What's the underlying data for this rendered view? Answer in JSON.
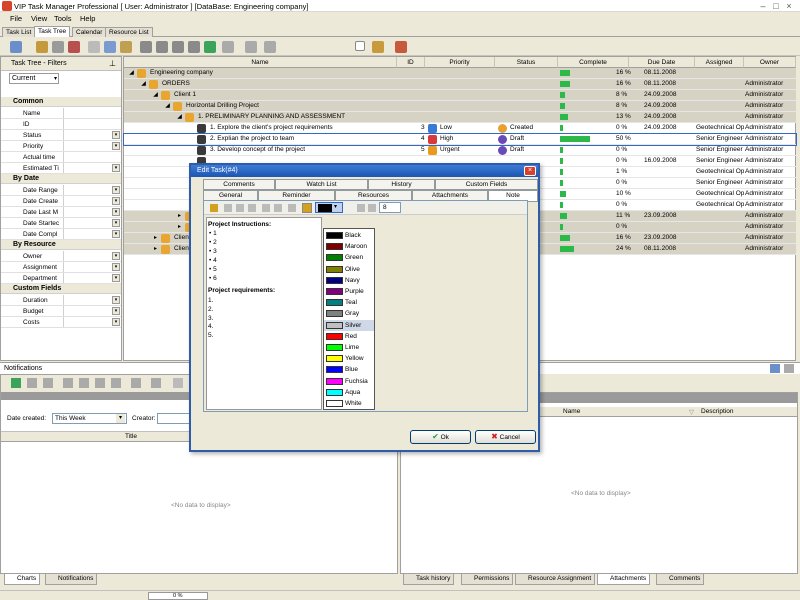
{
  "window": {
    "title": "VIP Task Manager Professional [ User: Administrator ] [DataBase: Engineering company]"
  },
  "menu": [
    "File",
    "View",
    "Tools",
    "Help"
  ],
  "main_tabs": [
    "Task List",
    "Task Tree",
    "Calendar",
    "Resource List"
  ],
  "left_panel": {
    "title": "Task Tree - Filters",
    "filter_value": "Current",
    "sections": [
      {
        "name": "Common",
        "props": [
          "Name",
          "ID",
          "Status",
          "Priority",
          "Actual time",
          "Estimated Ti"
        ]
      },
      {
        "name": "By Date",
        "props": [
          "Date Range",
          "Date Create",
          "Date Last M",
          "Date Startec",
          "Date Compl"
        ]
      },
      {
        "name": "By Resource",
        "props": [
          "Owner",
          "Assignment",
          "Department"
        ]
      },
      {
        "name": "Custom Fields",
        "props": [
          "Duration",
          "Budget",
          "Costs"
        ]
      }
    ]
  },
  "grid": {
    "headers": [
      "Name",
      "ID",
      "Priority",
      "Status",
      "Complete",
      "Due Date",
      "Assigned",
      "Owner"
    ],
    "rows": [
      {
        "name": "Engineering company",
        "level": 0,
        "grey": true,
        "id": "",
        "priority": "",
        "status": "",
        "complete": "16 %",
        "pct": 16,
        "due": "08.11.2008",
        "assigned": "",
        "owner": ""
      },
      {
        "name": "ORDERS",
        "level": 1,
        "grey": true,
        "id": "",
        "priority": "",
        "status": "",
        "complete": "16 %",
        "pct": 16,
        "due": "08.11.2008",
        "assigned": "",
        "owner": "Administrator"
      },
      {
        "name": "Client 1",
        "level": 2,
        "grey": true,
        "id": "",
        "priority": "",
        "status": "",
        "complete": "8 %",
        "pct": 8,
        "due": "24.09.2008",
        "assigned": "",
        "owner": "Administrator"
      },
      {
        "name": "Horizontal Drilling Project",
        "level": 3,
        "grey": true,
        "id": "",
        "priority": "",
        "status": "",
        "complete": "8 %",
        "pct": 8,
        "due": "24.09.2008",
        "assigned": "",
        "owner": "Administrator"
      },
      {
        "name": "1. PRELIMINARY PLANNING AND ASSESSMENT",
        "level": 4,
        "grey": true,
        "id": "",
        "priority": "",
        "status": "",
        "complete": "13 %",
        "pct": 13,
        "due": "24.09.2008",
        "assigned": "",
        "owner": "Administrator"
      },
      {
        "name": "1. Explore the client's project requirements",
        "level": 5,
        "grey": false,
        "id": "3",
        "priority": "Low",
        "status": "Created",
        "complete": "0 %",
        "pct": 0,
        "due": "24.09.2008",
        "assigned": "Geotechnical Op",
        "owner": "Administrator"
      },
      {
        "name": "2. Explian the project to team",
        "level": 5,
        "grey": false,
        "id": "4",
        "priority": "High",
        "status": "Draft",
        "complete": "50 %",
        "pct": 50,
        "due": "",
        "assigned": "Senior Engineer",
        "owner": "Administrator"
      },
      {
        "name": "3. Develop concept of the project",
        "level": 5,
        "grey": false,
        "id": "5",
        "priority": "Urgent",
        "status": "Draft",
        "complete": "0 %",
        "pct": 0,
        "due": "",
        "assigned": "Senior Engineer",
        "owner": "Administrator"
      },
      {
        "name": "",
        "level": 5,
        "grey": false,
        "id": "",
        "priority": "",
        "status": "",
        "complete": "0 %",
        "pct": 0,
        "due": "16.09.2008",
        "assigned": "Senior Engineer",
        "owner": "Administrator"
      },
      {
        "name": "",
        "level": 5,
        "grey": false,
        "id": "",
        "priority": "",
        "status": "",
        "complete": "1 %",
        "pct": 1,
        "due": "",
        "assigned": "Geotechnical Op",
        "owner": "Administrator"
      },
      {
        "name": "",
        "level": 5,
        "grey": false,
        "id": "",
        "priority": "",
        "status": "",
        "complete": "0 %",
        "pct": 0,
        "due": "",
        "assigned": "Senior Engineer",
        "owner": "Administrator"
      },
      {
        "name": "",
        "level": 5,
        "grey": false,
        "id": "",
        "priority": "",
        "status": "",
        "complete": "10 %",
        "pct": 10,
        "due": "",
        "assigned": "Geotechnical Op",
        "owner": "Administrator"
      },
      {
        "name": "",
        "level": 5,
        "grey": false,
        "id": "",
        "priority": "",
        "status": "",
        "complete": "0 %",
        "pct": 0,
        "due": "",
        "assigned": "Geotechnical Op",
        "owner": "Administrator"
      },
      {
        "name": "",
        "level": 4,
        "grey": true,
        "id": "",
        "priority": "",
        "status": "",
        "complete": "11 %",
        "pct": 11,
        "due": "23.09.2008",
        "assigned": "",
        "owner": "Administrator"
      },
      {
        "name": "",
        "level": 4,
        "grey": true,
        "id": "",
        "priority": "",
        "status": "",
        "complete": "0 %",
        "pct": 0,
        "due": "",
        "assigned": "",
        "owner": "Administrator"
      },
      {
        "name": "Client",
        "level": 2,
        "grey": true,
        "id": "",
        "priority": "",
        "status": "",
        "complete": "16 %",
        "pct": 16,
        "due": "23.09.2008",
        "assigned": "",
        "owner": "Administrator"
      },
      {
        "name": "Client",
        "level": 2,
        "grey": true,
        "id": "",
        "priority": "",
        "status": "",
        "complete": "24 %",
        "pct": 24,
        "due": "08.11.2008",
        "assigned": "",
        "owner": "Administrator"
      }
    ]
  },
  "notifications": {
    "title": "Notifications",
    "date_created_label": "Date created:",
    "date_created_value": "This Week",
    "creator_label": "Creator:",
    "col_title": "Title",
    "empty": "<No data to display>",
    "tabs": [
      "Charts",
      "Notifications"
    ]
  },
  "bottom_right": {
    "col_name": "Name",
    "col_desc": "Description",
    "empty": "<No data to display>",
    "tabs": [
      "Task history",
      "Permissions",
      "Resource Assignment",
      "Attachments",
      "Comments"
    ]
  },
  "status": {
    "progress": "0 %"
  },
  "dialog": {
    "title": "Edit Task(#4)",
    "tabs_top": [
      "Comments",
      "Watch List",
      "History",
      "Custom Fields"
    ],
    "tabs_bottom": [
      "General",
      "Reminder",
      "Resources",
      "Attachments",
      "Note"
    ],
    "font_size": "8",
    "instructions_heading": "Project Instructions:",
    "bullets": [
      "1",
      "2",
      "3",
      "4",
      "5",
      "6"
    ],
    "requirements_heading": "Project requirements:",
    "numbered": [
      "1.",
      "2.",
      "3.",
      "4.",
      "5."
    ],
    "ok": "Ok",
    "cancel": "Cancel",
    "colors": [
      {
        "name": "Black",
        "hex": "#000000"
      },
      {
        "name": "Maroon",
        "hex": "#800000"
      },
      {
        "name": "Green",
        "hex": "#008000"
      },
      {
        "name": "Olive",
        "hex": "#808000"
      },
      {
        "name": "Navy",
        "hex": "#000080"
      },
      {
        "name": "Purple",
        "hex": "#800080"
      },
      {
        "name": "Teal",
        "hex": "#008080"
      },
      {
        "name": "Gray",
        "hex": "#808080"
      },
      {
        "name": "Silver",
        "hex": "#c0c0c0"
      },
      {
        "name": "Red",
        "hex": "#ff0000"
      },
      {
        "name": "Lime",
        "hex": "#00ff00"
      },
      {
        "name": "Yellow",
        "hex": "#ffff00"
      },
      {
        "name": "Blue",
        "hex": "#0000ff"
      },
      {
        "name": "Fuchsia",
        "hex": "#ff00ff"
      },
      {
        "name": "Aqua",
        "hex": "#00ffff"
      },
      {
        "name": "White",
        "hex": "#ffffff"
      }
    ],
    "selected_color": "Silver"
  }
}
